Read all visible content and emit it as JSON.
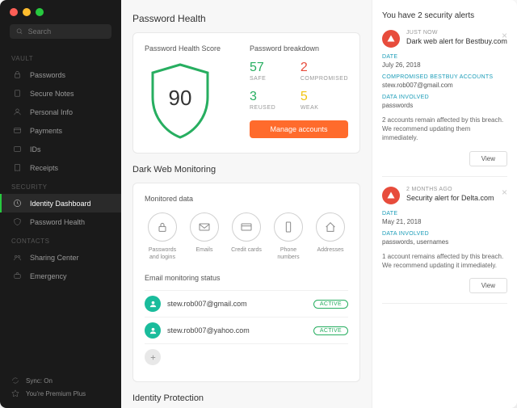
{
  "search_placeholder": "Search",
  "sidebar": {
    "vault_label": "VAULT",
    "vault_items": [
      "Passwords",
      "Secure Notes",
      "Personal Info",
      "Payments",
      "IDs",
      "Receipts"
    ],
    "security_label": "SECURITY",
    "security_items": [
      "Identity Dashboard",
      "Password Health"
    ],
    "contacts_label": "CONTACTS",
    "contacts_items": [
      "Sharing Center",
      "Emergency"
    ],
    "sync_label": "Sync: On",
    "plan_label": "You're Premium Plus"
  },
  "password_health": {
    "title": "Password Health",
    "score_label": "Password Health Score",
    "score": "90",
    "breakdown_label": "Password breakdown",
    "safe_num": "57",
    "safe_label": "SAFE",
    "comp_num": "2",
    "comp_label": "COMPROMISED",
    "reused_num": "3",
    "reused_label": "REUSED",
    "weak_num": "5",
    "weak_label": "WEAK",
    "manage_label": "Manage accounts"
  },
  "dark_web": {
    "title": "Dark Web Monitoring",
    "monitored_label": "Monitored data",
    "items": [
      "Passwords and logins",
      "Emails",
      "Credit cards",
      "Phone numbers",
      "Addresses"
    ],
    "email_status_label": "Email monitoring status",
    "emails": [
      {
        "addr": "stew.rob007@gmail.com",
        "status": "ACTIVE"
      },
      {
        "addr": "stew.rob007@yahoo.com",
        "status": "ACTIVE"
      }
    ]
  },
  "identity_title": "Identity Protection",
  "alerts": {
    "header": "You have 2 security alerts",
    "items": [
      {
        "time": "JUST NOW",
        "title": "Dark web alert for Bestbuy.com",
        "date_field": "DATE",
        "date": "July 26, 2018",
        "accounts_field": "COMPROMISED BESTBUY ACCOUNTS",
        "accounts": "stew.rob007@gmail.com",
        "data_field": "DATA INVOLVED",
        "data": "passwords",
        "desc": "2 accounts remain affected by this breach. We recommend updating them immediately.",
        "view": "View"
      },
      {
        "time": "2 MONTHS AGO",
        "title": "Security alert for Delta.com",
        "date_field": "DATE",
        "date": "May 21, 2018",
        "data_field": "DATA INVOLVED",
        "data": "passwords, usernames",
        "desc": "1 account remains affected by this breach. We recommend updating it immediately.",
        "view": "View"
      }
    ]
  }
}
